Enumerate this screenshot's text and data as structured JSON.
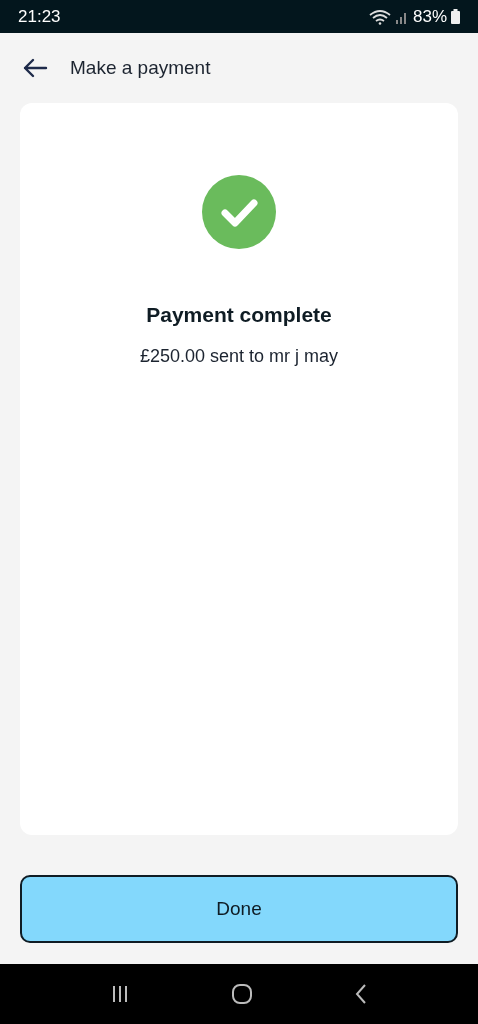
{
  "status_bar": {
    "time": "21:23",
    "battery": "83%"
  },
  "header": {
    "title": "Make a payment"
  },
  "confirmation": {
    "title": "Payment complete",
    "message": "£250.00 sent to mr j may"
  },
  "buttons": [
    "Done"
  ]
}
